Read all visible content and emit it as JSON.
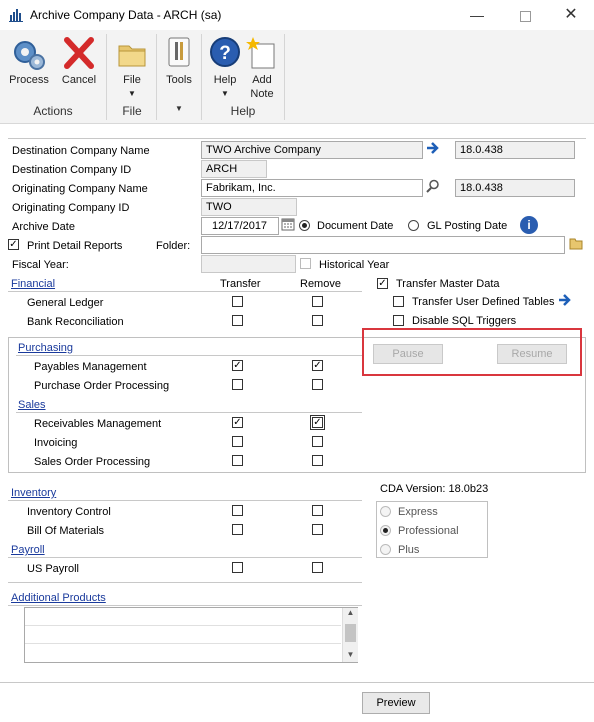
{
  "window": {
    "title": "Archive Company Data  -  ARCH (sa)",
    "minimize_icon": "minimize-icon",
    "maximize_icon": "maximize-icon",
    "close_icon": "close-icon"
  },
  "ribbon": {
    "groups": [
      {
        "label": "Actions",
        "buttons": [
          {
            "label": "Process",
            "icon": "gears-icon"
          },
          {
            "label": "Cancel",
            "icon": "red-x-icon"
          }
        ]
      },
      {
        "label": "File",
        "buttons": [
          {
            "label": "File",
            "icon": "folder-icon"
          }
        ]
      },
      {
        "label": "",
        "buttons": [
          {
            "label": "Tools",
            "icon": "tools-icon"
          }
        ]
      },
      {
        "label": "Help",
        "buttons": [
          {
            "label": "Help",
            "icon": "help-icon"
          },
          {
            "label": "Add\nNote",
            "icon": "note-icon",
            "label_line1": "Add",
            "label_line2": "Note"
          }
        ]
      }
    ]
  },
  "form": {
    "destination_company_name": {
      "label": "Destination Company Name",
      "value": "TWO Archive Company",
      "version": "18.0.438"
    },
    "destination_company_id": {
      "label": "Destination Company ID",
      "value": "ARCH"
    },
    "originating_company_name": {
      "label": "Originating Company Name",
      "value": "Fabrikam, Inc.",
      "version": "18.0.438"
    },
    "originating_company_id": {
      "label": "Originating Company ID",
      "value": "TWO"
    },
    "archive_date": {
      "label": "Archive Date",
      "value": "12/17/2017",
      "option_document": "Document Date",
      "option_gl": "GL Posting Date",
      "selected": "Document Date"
    },
    "print_detail_reports": {
      "label": "Print Detail Reports",
      "checked": true
    },
    "folder": {
      "label": "Folder:",
      "value": ""
    },
    "fiscal_year": {
      "label": "Fiscal Year:",
      "value": ""
    },
    "historical_year": {
      "label": "Historical Year",
      "checked": false
    }
  },
  "columns": {
    "transfer": "Transfer",
    "remove": "Remove"
  },
  "modules": {
    "financial": {
      "label": "Financial",
      "items": [
        {
          "label": "General Ledger",
          "transfer": false,
          "remove": false
        },
        {
          "label": "Bank Reconciliation",
          "transfer": false,
          "remove": false
        }
      ]
    },
    "purchasing": {
      "label": "Purchasing",
      "items": [
        {
          "label": "Payables Management",
          "transfer": true,
          "remove": true
        },
        {
          "label": "Purchase Order Processing",
          "transfer": false,
          "remove": false
        }
      ]
    },
    "sales": {
      "label": "Sales",
      "items": [
        {
          "label": "Receivables Management",
          "transfer": true,
          "remove": true
        },
        {
          "label": "Invoicing",
          "transfer": false,
          "remove": false
        },
        {
          "label": "Sales Order Processing",
          "transfer": false,
          "remove": false
        }
      ]
    },
    "inventory": {
      "label": "Inventory",
      "items": [
        {
          "label": "Inventory Control",
          "transfer": false,
          "remove": false
        },
        {
          "label": "Bill Of Materials",
          "transfer": false,
          "remove": false
        }
      ]
    },
    "payroll": {
      "label": "Payroll",
      "items": [
        {
          "label": "US Payroll",
          "transfer": false,
          "remove": false
        }
      ]
    },
    "additional": {
      "label": "Additional Products"
    }
  },
  "options": {
    "transfer_master_data": {
      "label": "Transfer Master Data",
      "checked": true
    },
    "transfer_user_defined_tables": {
      "label": "Transfer User Defined Tables",
      "checked": false
    },
    "disable_sql_triggers": {
      "label": "Disable SQL Triggers",
      "checked": false
    }
  },
  "actions": {
    "pause": "Pause",
    "resume": "Resume",
    "preview": "Preview",
    "highlight_color": "#d9363e"
  },
  "cda": {
    "version_label": "CDA Version: 18.0b23",
    "editions": [
      "Express",
      "Professional",
      "Plus"
    ],
    "selected": "Professional"
  }
}
